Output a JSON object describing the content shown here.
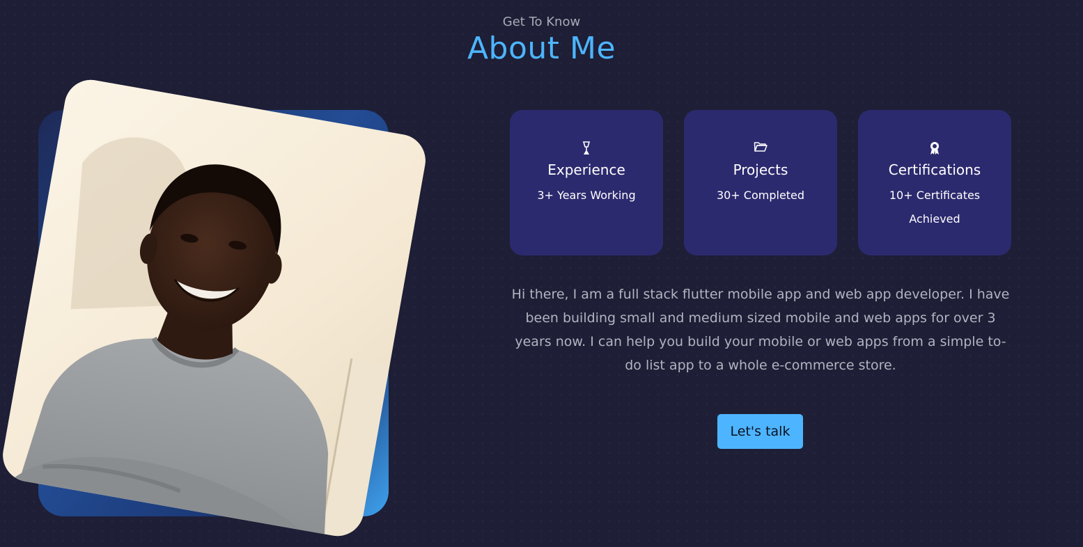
{
  "header": {
    "subtitle": "Get To Know",
    "title": "About Me"
  },
  "cards": [
    {
      "icon": "award-trophy-icon",
      "title": "Experience",
      "value": "3+ Years Working"
    },
    {
      "icon": "folder-icon",
      "title": "Projects",
      "value": "30+ Completed"
    },
    {
      "icon": "certificate-badge-icon",
      "title": "Certifications",
      "value": "10+ Certificates Achieved"
    }
  ],
  "bio": "Hi there, I am a full stack flutter mobile app and web app developer. I have been building small and medium sized mobile and web apps for over 3 years now. I can help you build your mobile or web apps from a simple to-do list app to a whole e-commerce store.",
  "cta": {
    "label": "Let's talk"
  },
  "colors": {
    "background": "#1e1e36",
    "accent": "#4db5ff",
    "card": "#2c2a6e",
    "muted_text": "#b3b3c2"
  }
}
